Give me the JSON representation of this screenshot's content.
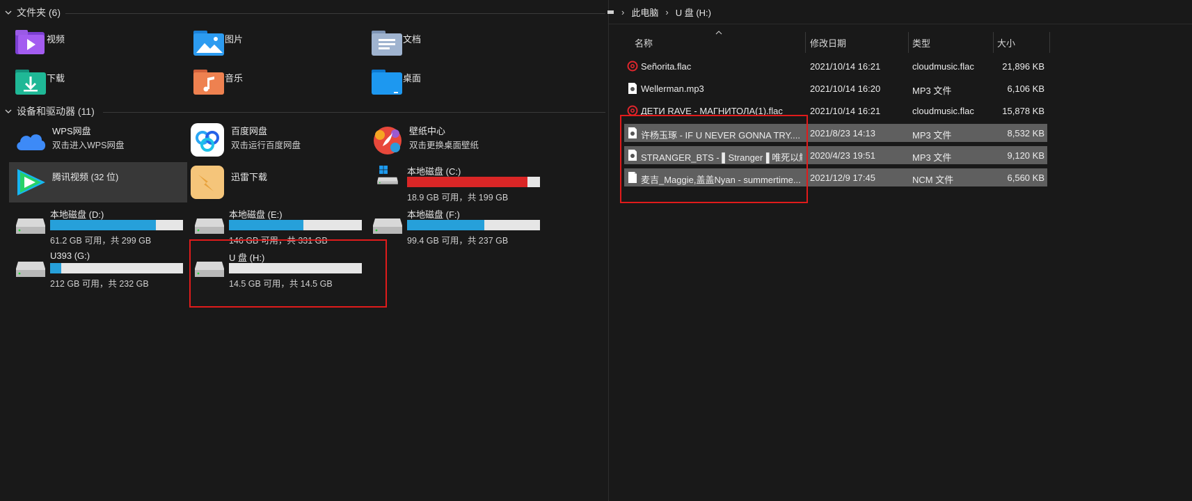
{
  "left": {
    "folders_header": "文件夹 (6)",
    "folders": [
      {
        "label": "视频",
        "icon": "videos-folder-icon"
      },
      {
        "label": "图片",
        "icon": "pictures-folder-icon"
      },
      {
        "label": "文档",
        "icon": "documents-folder-icon"
      },
      {
        "label": "下载",
        "icon": "downloads-folder-icon"
      },
      {
        "label": "音乐",
        "icon": "music-folder-icon"
      },
      {
        "label": "桌面",
        "icon": "desktop-folder-icon"
      }
    ],
    "devices_header": "设备和驱动器 (11)",
    "apps": [
      {
        "name": "WPS网盘",
        "sub": "双击进入WPS网盘",
        "icon": "wps-cloud-icon"
      },
      {
        "name": "百度网盘",
        "sub": "双击运行百度网盘",
        "icon": "baidu-netdisk-icon"
      },
      {
        "name": "壁纸中心",
        "sub": "双击更换桌面壁纸",
        "icon": "wallpaper-center-icon"
      },
      {
        "name": "腾讯视频 (32 位)",
        "sub": "",
        "icon": "tencent-video-icon"
      },
      {
        "name": "迅雷下载",
        "sub": "",
        "icon": "thunder-download-icon"
      }
    ],
    "drives": {
      "c": {
        "name": "本地磁盘 (C:)",
        "sub": "18.9 GB 可用，共 199 GB",
        "used_fraction": 0.905,
        "status_color": "#da2626"
      },
      "d": {
        "name": "本地磁盘 (D:)",
        "sub": "61.2 GB 可用，共 299 GB",
        "used_fraction": 0.795,
        "status_color": "#26a0da"
      },
      "e": {
        "name": "本地磁盘 (E:)",
        "sub": "146 GB 可用，共 331 GB",
        "used_fraction": 0.56,
        "status_color": "#26a0da"
      },
      "f": {
        "name": "本地磁盘 (F:)",
        "sub": "99.4 GB 可用，共 237 GB",
        "used_fraction": 0.58,
        "status_color": "#26a0da"
      },
      "g": {
        "name": "U393 (G:)",
        "sub": "212 GB 可用，共 232 GB",
        "used_fraction": 0.086,
        "status_color": "#26a0da"
      },
      "h": {
        "name": "U 盘 (H:)",
        "sub": "14.5 GB 可用，共 14.5 GB",
        "used_fraction": 0.0,
        "status_color": "#26a0da"
      }
    }
  },
  "right": {
    "breadcrumb": [
      "此电脑",
      "U 盘 (H:)"
    ],
    "columns": {
      "name": "名称",
      "date": "修改日期",
      "type": "类型",
      "size": "大小"
    },
    "files": [
      {
        "name": "Señorita.flac",
        "date": "2021/10/14 16:21",
        "type": "cloudmusic.flac",
        "size": "21,896 KB",
        "icon": "netease-music-icon",
        "selected": false
      },
      {
        "name": "Wellerman.mp3",
        "date": "2021/10/14 16:20",
        "type": "MP3 文件",
        "size": "6,106 KB",
        "icon": "audio-file-icon",
        "selected": false
      },
      {
        "name": "ДЕТИ RAVE - МАГНИТОЛА(1).flac",
        "date": "2021/10/14 16:21",
        "type": "cloudmusic.flac",
        "size": "15,878 KB",
        "icon": "netease-music-icon",
        "selected": false
      },
      {
        "name": "许杨玉琢 - IF U NEVER GONNA TRY....",
        "date": "2021/8/23 14:13",
        "type": "MP3 文件",
        "size": "8,532 KB",
        "icon": "audio-file-icon",
        "selected": true
      },
      {
        "name": "STRANGER_BTS - ▌Stranger▐ 唯死以解...",
        "date": "2020/4/23 19:51",
        "type": "MP3 文件",
        "size": "9,120 KB",
        "icon": "audio-file-icon",
        "selected": true
      },
      {
        "name": "麦吉_Maggie,盖盖Nyan - summertime...",
        "date": "2021/12/9 17:45",
        "type": "NCM 文件",
        "size": "6,560 KB",
        "icon": "generic-file-icon",
        "selected": true
      }
    ]
  },
  "colors": {
    "background": "#191919",
    "selection": "#5f5f5f",
    "tile_selected": "#383838",
    "drive_bar": "#26a0da",
    "drive_bar_full": "#da2626",
    "annotation_box": "#e01b1b"
  }
}
